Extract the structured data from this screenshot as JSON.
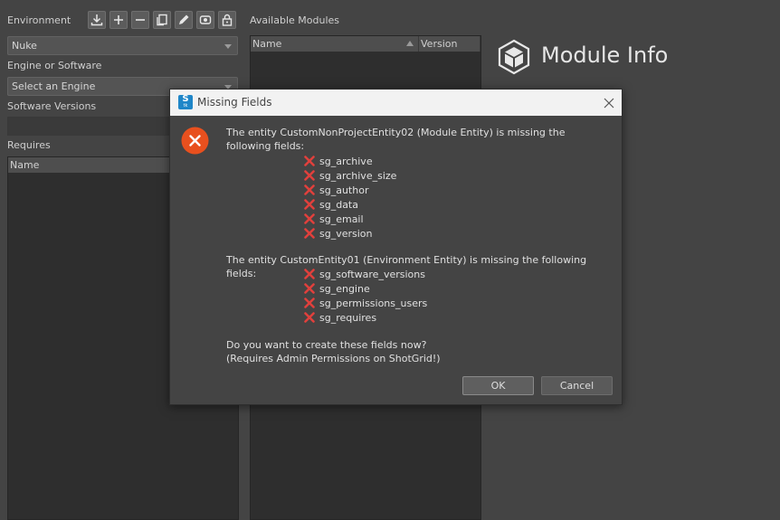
{
  "left": {
    "environment_label": "Environment",
    "environment_value": "Nuke",
    "engine_label": "Engine or Software",
    "engine_value": "Select an Engine",
    "software_versions_label": "Software Versions",
    "requires_label": "Requires",
    "requires_col_name": "Name"
  },
  "modules": {
    "label": "Available Modules",
    "col_name": "Name",
    "col_version": "Version"
  },
  "module_info": {
    "title": "Module Info"
  },
  "dialog": {
    "title": "Missing Fields",
    "app_icon_letters": "S",
    "app_icon_sub": "tk",
    "message1": "The entity CustomNonProjectEntity02 (Module Entity) is missing the following fields:",
    "fields1": [
      "sg_archive",
      "sg_archive_size",
      "sg_author",
      "sg_data",
      "sg_email",
      "sg_version"
    ],
    "message2": "The entity CustomEntity01 (Environment Entity) is missing the following fields:",
    "fields2": [
      "sg_software_versions",
      "sg_engine",
      "sg_permissions_users",
      "sg_requires"
    ],
    "question": "Do you want to create these fields now?",
    "note": "(Requires Admin Permissions on ShotGrid!)",
    "ok_label": "OK",
    "cancel_label": "Cancel"
  },
  "colors": {
    "background": "#444444",
    "error": "#e8501e",
    "x_mark": "#e0403c",
    "titlebar": "#f2f2f2"
  }
}
